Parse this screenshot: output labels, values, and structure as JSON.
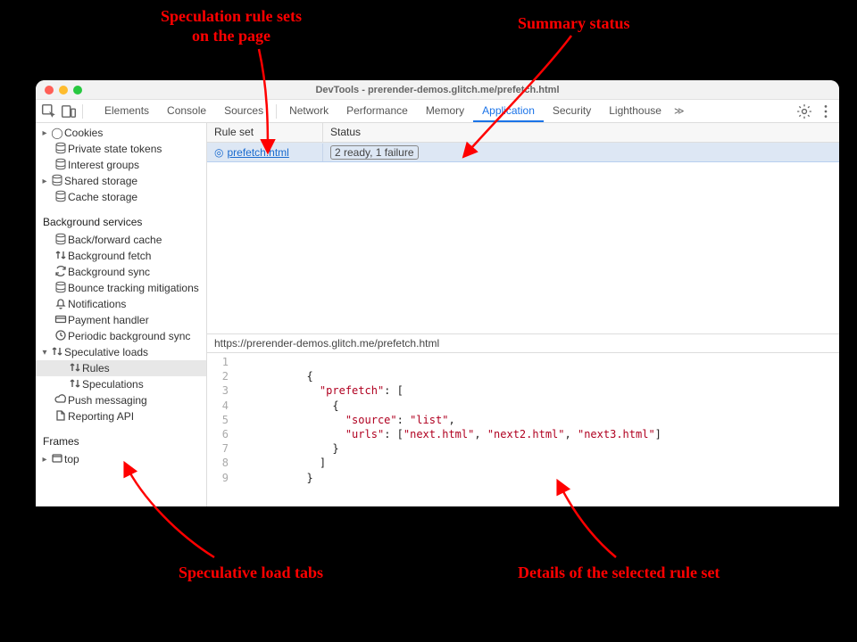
{
  "window": {
    "title": "DevTools - prerender-demos.glitch.me/prefetch.html"
  },
  "tabs": [
    {
      "label": "Elements",
      "active": false
    },
    {
      "label": "Console",
      "active": false
    },
    {
      "label": "Sources",
      "active": false
    },
    {
      "label": "Network",
      "active": false
    },
    {
      "label": "Performance",
      "active": false
    },
    {
      "label": "Memory",
      "active": false
    },
    {
      "label": "Application",
      "active": true
    },
    {
      "label": "Security",
      "active": false
    },
    {
      "label": "Lighthouse",
      "active": false
    }
  ],
  "sidebar": {
    "section_background": "Background services",
    "section_frames": "Frames",
    "items": {
      "cookies": "Cookies",
      "private_state_tokens": "Private state tokens",
      "interest_groups": "Interest groups",
      "shared_storage": "Shared storage",
      "cache_storage": "Cache storage",
      "bfcache": "Back/forward cache",
      "background_fetch": "Background fetch",
      "background_sync": "Background sync",
      "bounce": "Bounce tracking mitigations",
      "notifications": "Notifications",
      "payment": "Payment handler",
      "periodic": "Periodic background sync",
      "speculative": "Speculative loads",
      "rules": "Rules",
      "speculations": "Speculations",
      "push": "Push messaging",
      "reporting": "Reporting API",
      "top": "top"
    }
  },
  "table": {
    "head_rule": "Rule set",
    "head_status": "Status",
    "rows": [
      {
        "rule": "prefetch.html",
        "status": "2 ready, 1 failure"
      }
    ]
  },
  "detail": {
    "url": "https://prerender-demos.glitch.me/prefetch.html",
    "code": {
      "lines": [
        "1",
        "2",
        "3",
        "4",
        "5",
        "6",
        "7",
        "8",
        "9"
      ],
      "text": [
        "",
        "{",
        "  \"prefetch\": [",
        "    {",
        "      \"source\": \"list\",",
        "      \"urls\": [\"next.html\", \"next2.html\", \"next3.html\"]",
        "    }",
        "  ]",
        "}"
      ]
    }
  },
  "annotations": {
    "top_left": "Speculation rule sets\non the page",
    "top_right": "Summary status",
    "bottom_left": "Speculative load tabs",
    "bottom_right": "Details of the selected rule set"
  }
}
